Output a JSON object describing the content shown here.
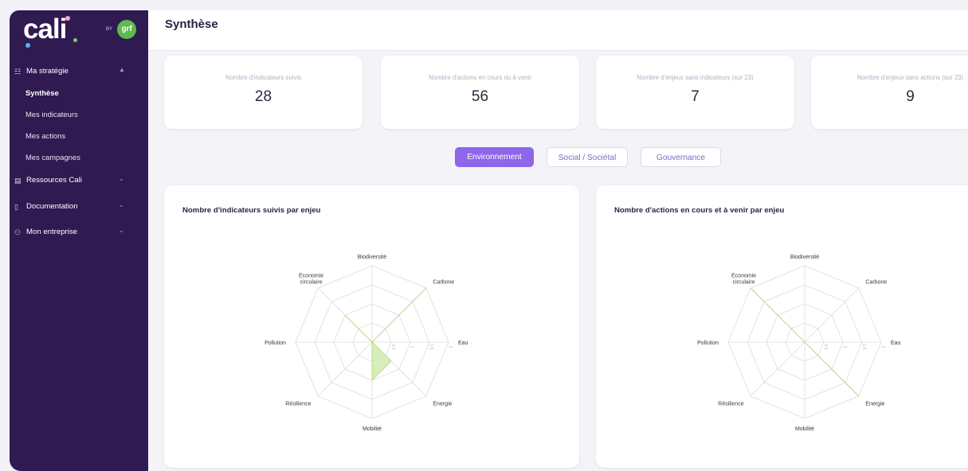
{
  "brand": {
    "logo_text": "cali",
    "by_label": "BY",
    "badge_text": "grf",
    "colors": {
      "sidebar": "#2f1a52",
      "accent": "#8e66ea",
      "badge": "#5eb94e"
    }
  },
  "sidebar": {
    "sections": [
      {
        "label": "Ma stratégie",
        "icon": "strategy-icon",
        "expanded": true
      },
      {
        "label": "Ressources Cali",
        "icon": "book-icon",
        "expanded": false
      },
      {
        "label": "Documentation",
        "icon": "document-icon",
        "expanded": false
      },
      {
        "label": "Mon entreprise",
        "icon": "people-icon",
        "expanded": false
      }
    ],
    "subitems": [
      {
        "label": "Synthèse",
        "active": true
      },
      {
        "label": "Mes indicateurs",
        "active": false
      },
      {
        "label": "Mes actions",
        "active": false
      },
      {
        "label": "Mes campagnes",
        "active": false
      }
    ]
  },
  "header": {
    "title": "Synthèse"
  },
  "kpis": [
    {
      "label": "Nombre d'indicateurs suivis",
      "value": "28"
    },
    {
      "label": "Nombre d'actions en cours ou à venir",
      "value": "56"
    },
    {
      "label": "Nombre d'enjeux sans indicateurs (sur 23)",
      "value": "7"
    },
    {
      "label": "Nombre d'enjeux sans actions (sur 23)",
      "value": "9"
    }
  ],
  "tabs": [
    {
      "label": "Environnement",
      "active": true
    },
    {
      "label": "Social / Sociétal",
      "active": false
    },
    {
      "label": "Gouvernance",
      "active": false
    }
  ],
  "chart_data": [
    {
      "type": "radar",
      "title": "Nombre d'indicateurs suivis par enjeu",
      "categories": [
        "Biodiversité",
        "Carbone",
        "Eau",
        "Energie",
        "Mobilité",
        "Résilience",
        "Pollution",
        "Economie circulaire"
      ],
      "tick_labels": [
        "0",
        "0.5",
        "1",
        "1.5",
        "2"
      ],
      "rmax": 2,
      "values": [
        0,
        2,
        0,
        0.7,
        1,
        0,
        0,
        1
      ],
      "line_color": "#c3dd8e",
      "fill_color": "#c9e8a6"
    },
    {
      "type": "radar",
      "title": "Nombre d'actions en cours et à venir par enjeu",
      "categories": [
        "Biodiversité",
        "Carbone",
        "Eau",
        "Energie",
        "Mobilité",
        "Résilience",
        "Pollution",
        "Economie circulaire"
      ],
      "tick_labels": [
        "0",
        "0.5",
        "1",
        "1.5",
        "2"
      ],
      "rmax": 2,
      "values": [
        0,
        0,
        0,
        2,
        0,
        0,
        0,
        2
      ],
      "line_color": "#c3dd8e",
      "fill_color": "#c9e8a6"
    }
  ]
}
